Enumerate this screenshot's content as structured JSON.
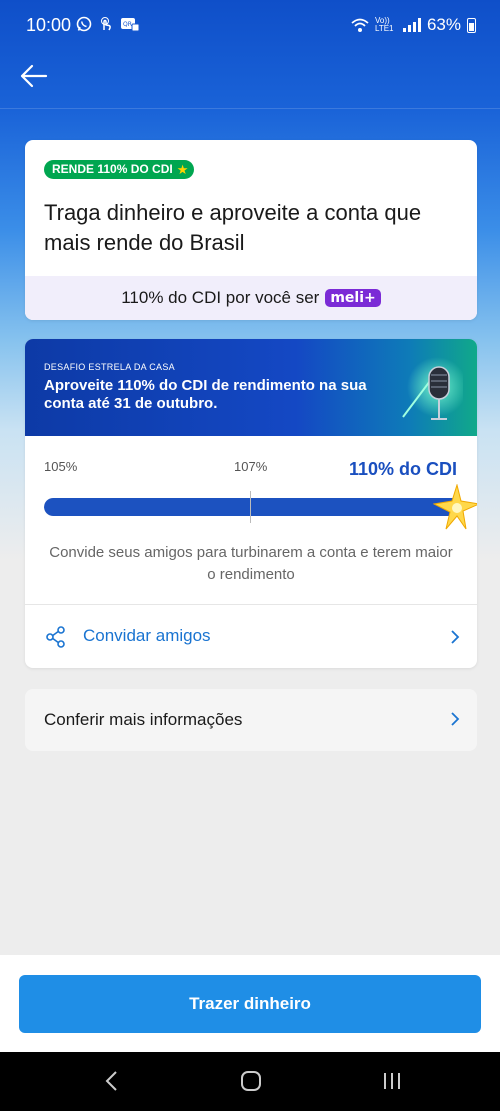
{
  "status_bar": {
    "time": "10:00",
    "network": "Vo)) LTE1",
    "battery": "63%"
  },
  "hero_card": {
    "badge": "RENDE 110% DO CDI",
    "title": "Traga dinheiro e aproveite a conta que mais rende do Brasil",
    "meli_text": "110% do CDI por você ser",
    "meli_badge": "meli+"
  },
  "challenge_card": {
    "kicker": "DESAFIO ESTRELA DA CASA",
    "headline": "Aproveite 110% do CDI de rendimento na sua conta até 31 de outubro.",
    "scale_start": "105%",
    "scale_mid": "107%",
    "current_label": "110% do CDI",
    "progress": 1.0,
    "invite_text": "Convide seus amigos para turbinarem a conta e terem maior o rendimento",
    "invite_button": "Convidar amigos"
  },
  "more_info": {
    "label": "Conferir mais informações"
  },
  "cta": {
    "label": "Trazer dinheiro"
  },
  "icons": [
    "back-arrow-icon",
    "whatsapp-icon",
    "share-icon",
    "chevron-right-icon",
    "microphone-icon",
    "sparkle-star-icon"
  ],
  "colors": {
    "primary_blue": "#1f8ee6",
    "progress_blue": "#1c52c0",
    "badge_green": "#00a650",
    "meli_purple": "#7b2bd6",
    "link_blue": "#1a74d1"
  }
}
